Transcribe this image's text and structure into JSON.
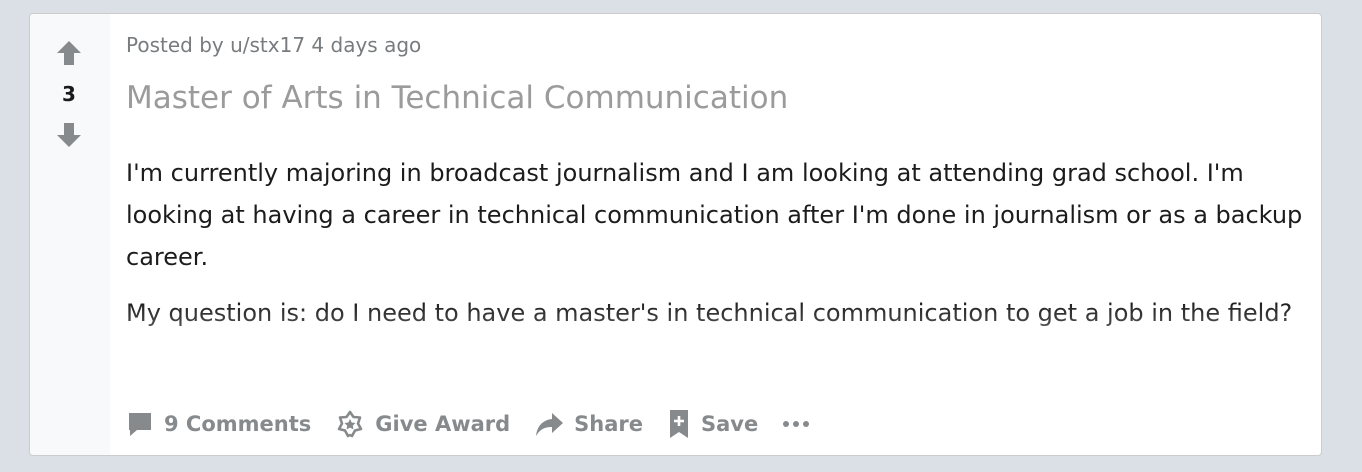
{
  "post": {
    "score": "3",
    "meta": {
      "posted_by": "Posted by",
      "author": "u/stx17",
      "age": "4 days ago"
    },
    "title": "Master of Arts in Technical Communication",
    "body": [
      "I'm currently majoring in broadcast journalism and I am looking at attending grad school. I'm looking at having a career in technical communication after I'm done in journalism or as a backup career.",
      "My question is: do I need to have a master's in technical communication to get a job in the field?"
    ],
    "actions": {
      "comments": "9 Comments",
      "award": "Give Award",
      "share": "Share",
      "save": "Save"
    }
  },
  "icons": {
    "upvote": "upvote-arrow-icon",
    "downvote": "downvote-arrow-icon",
    "comments": "comment-bubble-icon",
    "award": "award-icon",
    "share": "share-arrow-icon",
    "save": "bookmark-icon",
    "more": "more-dots-icon"
  },
  "colors": {
    "page_background": "#dae0e6",
    "card_background": "#ffffff",
    "vote_column": "#f8f9fa",
    "icon_gray": "#878a8c",
    "text_dark": "#1c1c1c"
  }
}
